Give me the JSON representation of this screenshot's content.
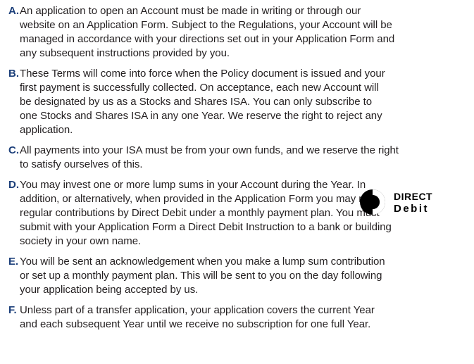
{
  "clauses": [
    {
      "letter": "A.",
      "lines": [
        "An application to open an Account must be made in writing or through our",
        "website on an Application Form. Subject to the Regulations, your Account will be",
        "managed in accordance with your directions set out in your Application Form and",
        "any subsequent instructions provided by you."
      ]
    },
    {
      "letter": "B.",
      "lines": [
        "These Terms will come into force when the Policy document is issued and your",
        "first payment is successfully collected. On acceptance, each new Account will",
        "be designated by us as a Stocks and Shares ISA. You can only subscribe to",
        "one Stocks and Shares ISA in any one Year. We reserve the right to reject any",
        "application."
      ]
    },
    {
      "letter": "C.",
      "lines": [
        "All payments into your ISA must be from your own funds, and we reserve the right",
        "to satisfy ourselves of this."
      ]
    },
    {
      "letter": "D.",
      "lines": [
        "You may invest one or more lump sums in your Account during the Year. In",
        "addition, or alternatively, when provided in the Application Form you may make",
        "regular contributions by Direct Debit under a monthly payment plan. You must",
        "submit with your Application Form a Direct Debit Instruction to a bank or building",
        "society in your own name."
      ]
    },
    {
      "letter": "E.",
      "lines": [
        "You will be sent an acknowledgement when you make a lump sum contribution",
        "or set up a monthly payment plan. This will be sent to you on the day following",
        "your application being accepted by us."
      ]
    },
    {
      "letter": "F.",
      "lines": [
        "Unless part of a transfer application, your application covers the current Year",
        "and each subsequent Year until we receive no subscription for one full Year."
      ]
    }
  ],
  "logo": {
    "line1": "DIRECT",
    "line2": "Debit"
  },
  "colors": {
    "letter": "#1c3f7a",
    "text": "#231f20",
    "logo": "#000000"
  }
}
